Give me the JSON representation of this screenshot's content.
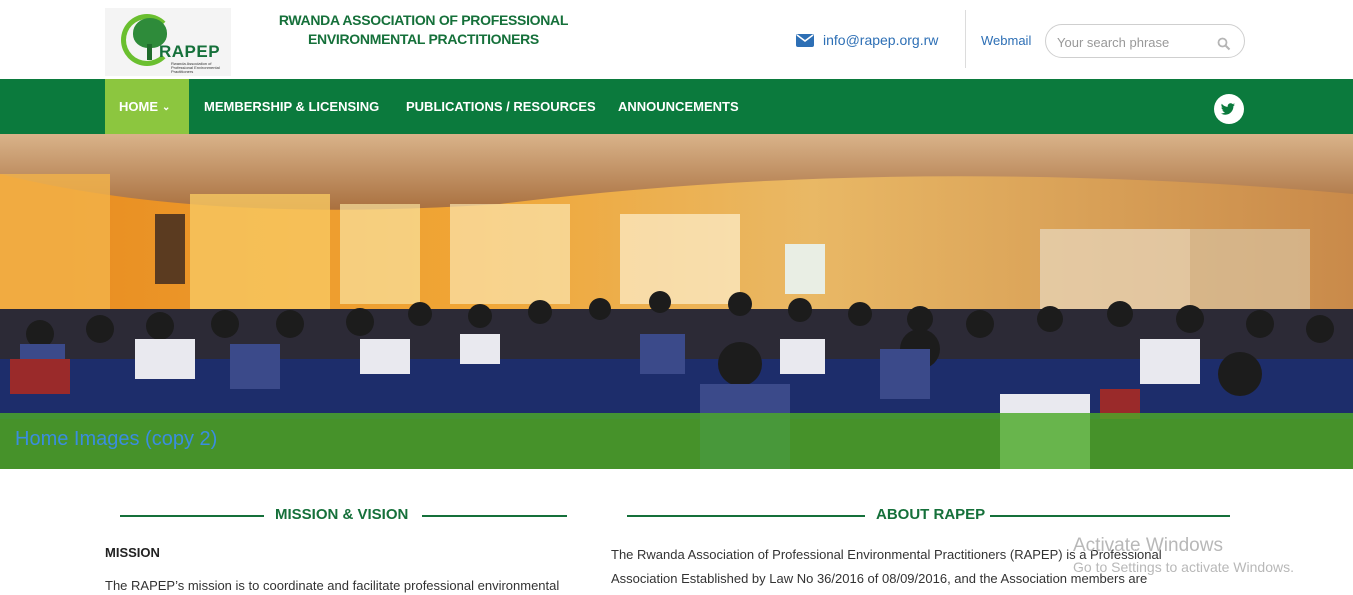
{
  "header": {
    "logo_text": "RAPEP",
    "logo_subtext": "Rwanda Association of Professional Environmental Practitioners",
    "org_name_line1": "RWANDA ASSOCIATION OF PROFESSIONAL",
    "org_name_line2": "ENVIRONMENTAL PRACTITIONERS",
    "email": "info@rapep.org.rw",
    "webmail_label": "Webmail",
    "search_placeholder": "Your search phrase"
  },
  "nav": {
    "items": [
      {
        "label": "HOME",
        "active": true
      },
      {
        "label": "MEMBERSHIP & LICENSING"
      },
      {
        "label": "PUBLICATIONS / RESOURCES"
      },
      {
        "label": "ANNOUNCEMENTS"
      }
    ],
    "social_icon": "twitter-icon"
  },
  "hero": {
    "caption": "Home Images (copy 2)"
  },
  "sections": {
    "mission": {
      "title": "MISSION & VISION",
      "label": "MISSION",
      "text": "The RAPEP’s mission is to coordinate and facilitate professional environmental"
    },
    "about": {
      "title": "ABOUT RAPEP",
      "text": "The Rwanda Association of Professional Environmental Practitioners (RAPEP) is a Professional Association Established by Law No 36/2016 of 08/09/2016, and the Association members are"
    }
  },
  "watermark": {
    "title": "Activate Windows",
    "subtitle": "Go to Settings to activate Windows."
  },
  "colors": {
    "brand_green": "#0b7a3d",
    "active_green": "#8cc63f",
    "link_blue": "#2d6fb5"
  }
}
